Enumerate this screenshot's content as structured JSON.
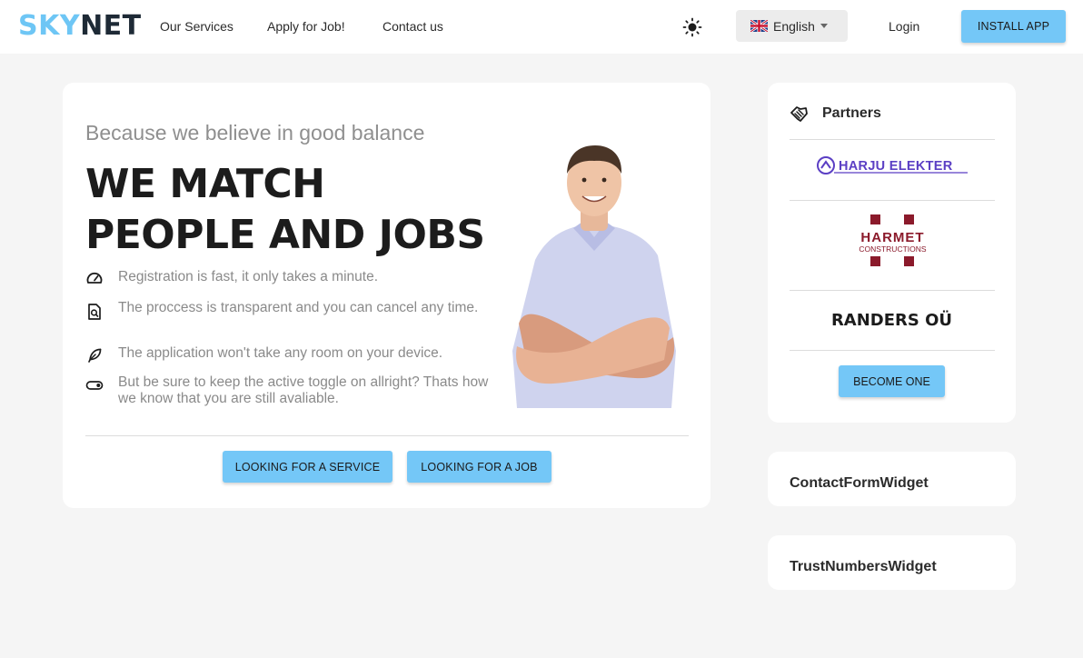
{
  "header": {
    "logo_part1": "SKY",
    "logo_part2": "NET",
    "nav": [
      "Our Services",
      "Apply for Job!",
      "Contact us"
    ],
    "language": "English",
    "login": "Login",
    "install": "INSTALL APP",
    "icons": {
      "theme": "sun-icon",
      "flag": "uk-flag-icon",
      "caret": "caret-down-icon"
    }
  },
  "hero": {
    "subtitle": "Because we believe in good balance",
    "headline_line1": "WE MATCH",
    "headline_line2": "PEOPLE AND JOBS",
    "features": [
      {
        "icon": "speedometer-icon",
        "text": "Registration is fast, it only takes a minute."
      },
      {
        "icon": "document-search-icon",
        "text": "The proccess is transparent and you can cancel any time."
      },
      {
        "icon": "feather-icon",
        "text": "The application won't take any room on your device."
      },
      {
        "icon": "toggle-icon",
        "text": "But be sure to keep the active toggle on allright? Thats how we know that you are still avaliable."
      }
    ],
    "cta_service": "LOOKING FOR A SERVICE",
    "cta_job": "LOOKING FOR A JOB"
  },
  "partners": {
    "title": "Partners",
    "icon": "handshake-icon",
    "logos": {
      "harju": "HARJU ELEKTER",
      "harmet_name": "HARMET",
      "harmet_sub": "CONSTRUCTIONS"
    },
    "randers": "RANDERS OÜ",
    "become": "BECOME ONE"
  },
  "widgets": {
    "contact": "ContactFormWidget",
    "trust": "TrustNumbersWidget"
  },
  "colors": {
    "accent": "#74c7f7",
    "logo_sky": "#6ec6f5",
    "logo_net": "#1e2a36",
    "harju": "#5b3fc4",
    "harmet": "#8b1a2b"
  }
}
